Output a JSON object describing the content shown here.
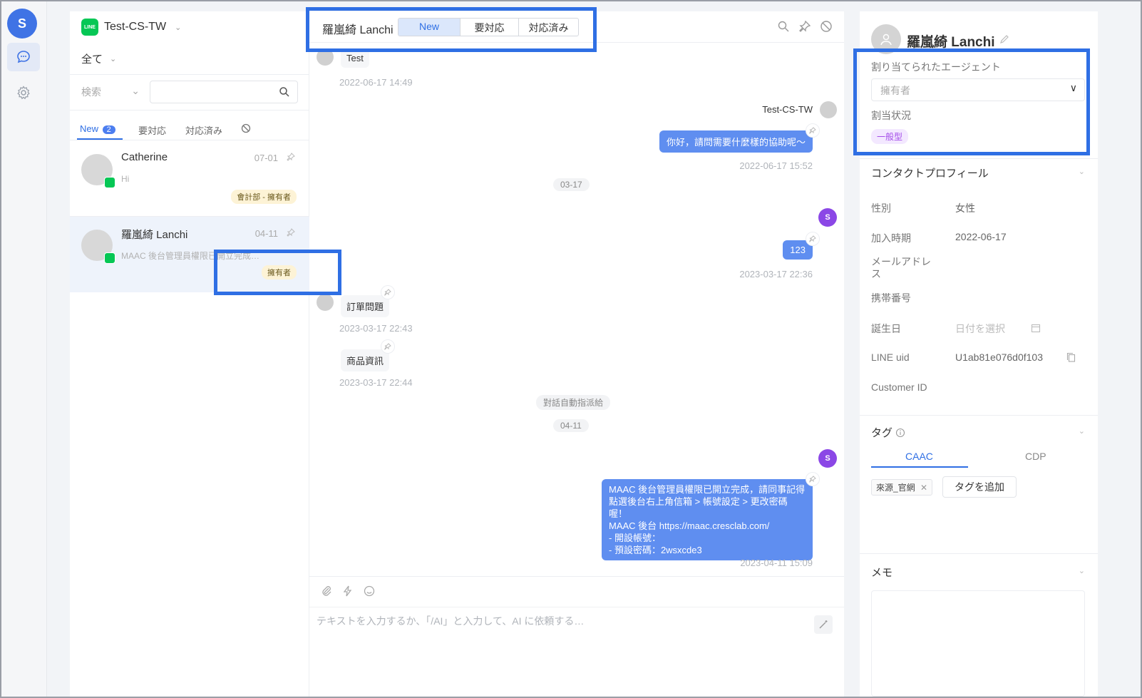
{
  "rail": {
    "logo_text": "S",
    "items": [
      {
        "icon": "chat-icon"
      },
      {
        "icon": "gear-icon"
      }
    ]
  },
  "list": {
    "channel": "Test-CS-TW",
    "line_label": "LINE",
    "filter": "全て",
    "search_type": "検索",
    "search_value": "",
    "tabs": [
      {
        "label": "New",
        "count": "2"
      },
      {
        "label": "要対応"
      },
      {
        "label": "対応済み"
      }
    ],
    "conversations": [
      {
        "name": "Catherine",
        "date": "07-01",
        "preview": "Hi",
        "tag": "會計部 - 擁有者"
      },
      {
        "name": "羅嵐綺 Lanchi",
        "date": "04-11",
        "preview": "MAAC 後台管理員權限已開立完成…",
        "tag": "擁有者"
      }
    ]
  },
  "chat": {
    "contact": "羅嵐綺 Lanchi",
    "status_tabs": [
      "New",
      "要対応",
      "対応済み"
    ],
    "messages": {
      "m1": {
        "text": "Test",
        "time": "2022-06-17 14:49"
      },
      "m2_sender": "Test-CS-TW",
      "m2": {
        "text": "你好，請問需要什麼樣的協助呢～",
        "time": "2022-06-17 15:52"
      },
      "date1": "03-17",
      "brand_avatar": "S",
      "m3": {
        "text": "123",
        "time": "2023-03-17 22:36"
      },
      "m4": {
        "text": "訂單問題",
        "time": "2023-03-17 22:43"
      },
      "m5": {
        "text": "商品資訊",
        "time": "2023-03-17 22:44"
      },
      "sys1": "對話自動指派給",
      "date2": "04-11",
      "m6": {
        "line1": "MAAC 後台管理員權限已開立完成，請同事記得",
        "line2": "點選後台右上角信箱 > 帳號設定 > 更改密碼喔！",
        "line3_prefix": "MAAC 後台 ",
        "link": "https://maac.cresclab.com/",
        "line4": "- 開設帳號：",
        "line5": "- 預設密碼：2wsxcde3",
        "time": "2023-04-11 15:09"
      }
    },
    "composer_placeholder": "テキストを入力するか、「/AI」と入力して、AI に依頼する…"
  },
  "panel": {
    "name": "羅嵐綺 Lanchi",
    "assigned_label": "割り当てられたエージェント",
    "assigned_placeholder": "擁有者",
    "status_label": "割当状況",
    "status_tag": "一般型",
    "profile_title": "コンタクトプロフィール",
    "fields": {
      "gender_label": "性別",
      "gender": "女性",
      "joined_label": "加入時期",
      "joined": "2022-06-17",
      "email_label_1": "メールアドレ",
      "email_label_2": "ス",
      "phone_label": "携帯番号",
      "birthday_label": "誕生日",
      "birthday_placeholder": "日付を選択",
      "lineuid_label": "LINE uid",
      "lineuid": "U1ab81e076d0f103",
      "customer_label": "Customer ID"
    },
    "tags_title": "タグ",
    "tag_tabs": [
      "CAAC",
      "CDP"
    ],
    "tag_chip": "來源_官網",
    "add_tag": "タグを追加",
    "memo_title": "メモ"
  },
  "colors": {
    "accent": "#2f6fe4",
    "bubble": "#5f8ef0",
    "line_green": "#06c755",
    "brand_purple": "#8b47e6"
  }
}
